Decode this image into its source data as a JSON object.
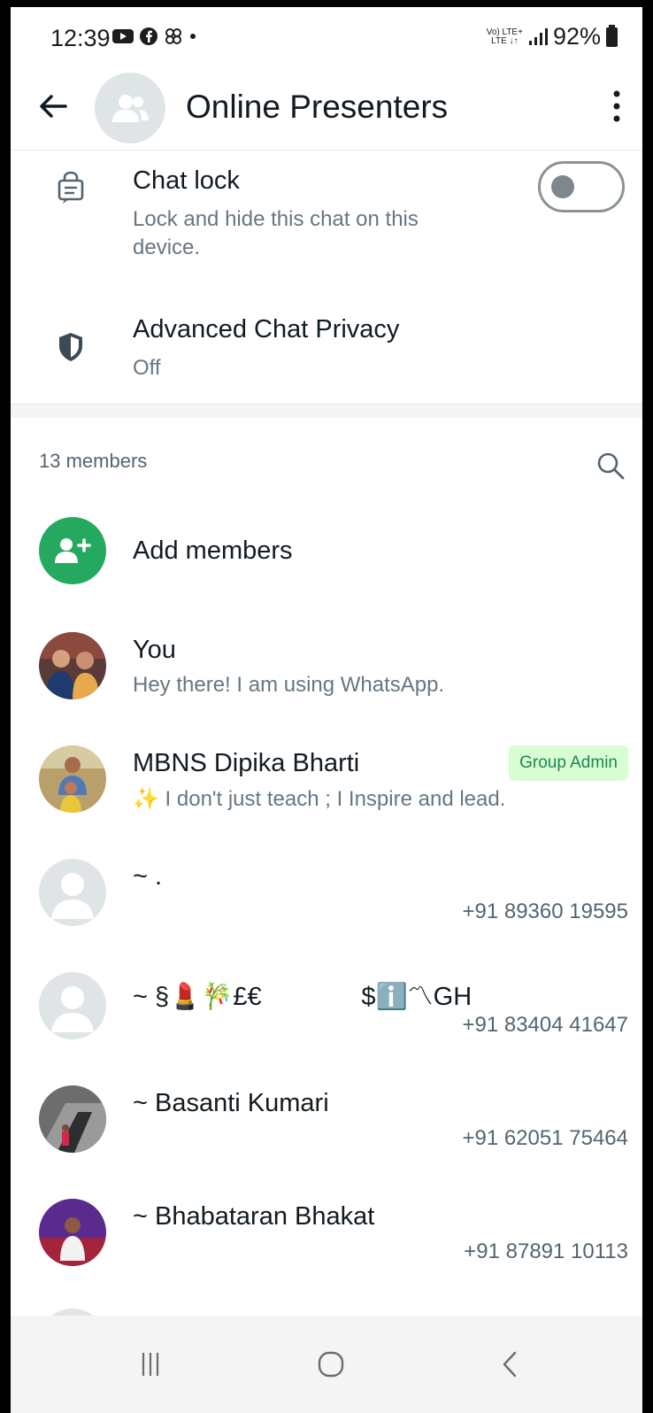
{
  "status_bar": {
    "time": "12:39",
    "network_top": "Vo) LTE+",
    "network_bottom": "LTE ↓↑",
    "battery": "92%"
  },
  "header": {
    "title": "Online Presenters"
  },
  "chat_lock": {
    "title": "Chat lock",
    "subtitle_line1": "Lock and hide this chat on this",
    "subtitle_line2": "device.",
    "enabled": false
  },
  "advanced_privacy": {
    "title": "Advanced Chat Privacy",
    "value": "Off"
  },
  "members": {
    "count_label": "13 members",
    "add_label": "Add members",
    "list": [
      {
        "name": "You",
        "about": "Hey there! I am using WhatsApp.",
        "phone": "",
        "badge": ""
      },
      {
        "name": "MBNS Dipika Bharti",
        "about": "✨ I don't just teach ; I Inspire and lead.",
        "phone": "",
        "badge": "Group Admin"
      },
      {
        "name": "~ .",
        "about": "",
        "phone": "+91 89360 19595",
        "badge": ""
      },
      {
        "name": "~ §💄🎋£€              $ℹ️〽GH",
        "about": "",
        "phone": "+91 83404 41647",
        "badge": ""
      },
      {
        "name": "~ Basanti Kumari",
        "about": "",
        "phone": "+91 62051 75464",
        "badge": ""
      },
      {
        "name": "~ Bhabataran Bhakat",
        "about": "",
        "phone": "+91 87891 10113",
        "badge": ""
      }
    ]
  },
  "colors": {
    "accent_green": "#25a85f",
    "admin_badge_bg": "#d9fdd3",
    "admin_badge_text": "#1b8755"
  },
  "icons": {
    "back": "arrow-left-icon",
    "menu": "more-vert-icon",
    "lock": "chat-lock-icon",
    "shield": "shield-icon",
    "search": "search-icon",
    "add": "add-person-icon"
  }
}
